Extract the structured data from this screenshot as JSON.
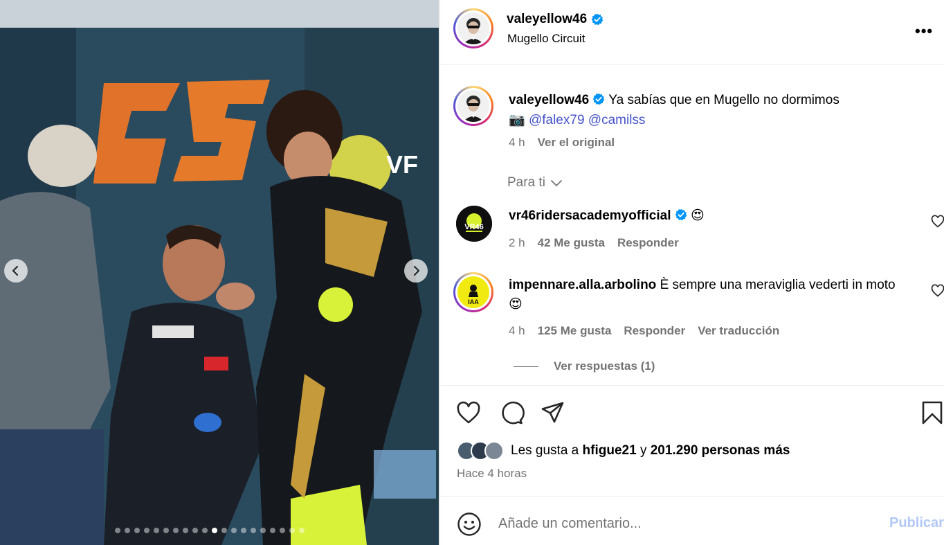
{
  "post": {
    "username": "valeyellow46",
    "location": "Mugello Circuit",
    "more_label": "•••"
  },
  "caption": {
    "username": "valeyellow46",
    "text": "Ya sabías que en Mugello no dormimos",
    "camera_emoji": "📷",
    "mention1": "@falex79",
    "mention2": "@camilss",
    "time": "4 h",
    "see_original": "Ver el original"
  },
  "section": {
    "para_ti": "Para ti"
  },
  "comments": [
    {
      "username": "vr46ridersacademyofficial",
      "text": "😍",
      "time": "2 h",
      "likes": "42 Me gusta",
      "reply": "Responder"
    },
    {
      "username": "impennare.alla.arbolino",
      "text": "È sempre una meraviglia vederti in moto 😍",
      "time": "4 h",
      "likes": "125 Me gusta",
      "reply": "Responder",
      "translate": "Ver traducción",
      "view_replies": "Ver respuestas (1)"
    }
  ],
  "likes": {
    "prefix": "Les gusta a",
    "user": "hfigue21",
    "joiner": "y",
    "others": "201.290 personas más",
    "time_ago": "Hace 4 horas"
  },
  "composer": {
    "placeholder": "Añade un comentario...",
    "publish": "Publicar"
  },
  "carousel": {
    "total_slides": 20,
    "active_index": 10
  },
  "colors": {
    "verified": "#0095f6",
    "mention": "#4553c9",
    "publish_disabled": "#b2c8f7"
  },
  "icons": [
    "chevron-left-icon",
    "chevron-right-icon",
    "heart-icon",
    "comment-icon",
    "share-icon",
    "bookmark-icon",
    "emoji-icon",
    "chevron-down-icon",
    "verified-icon"
  ]
}
